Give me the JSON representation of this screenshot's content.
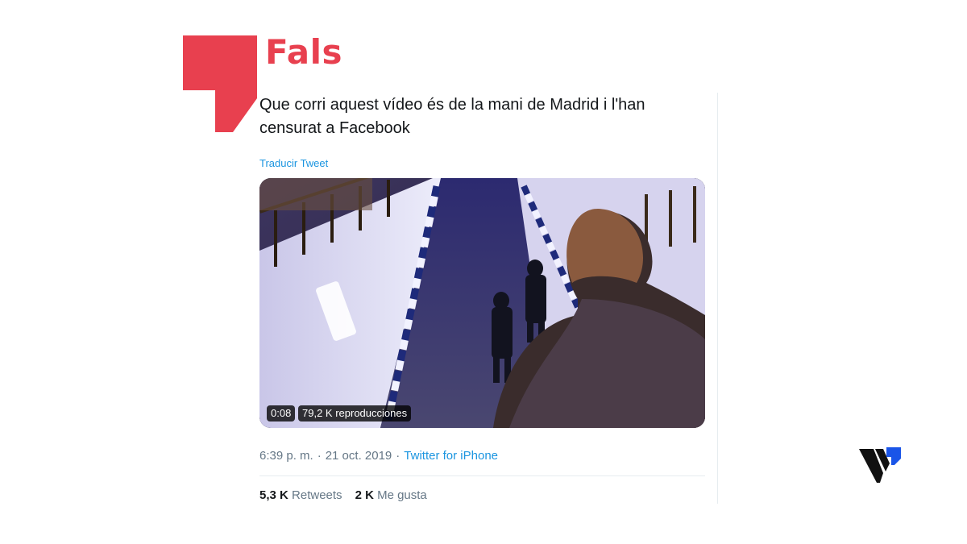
{
  "verdict": {
    "label": "Fals",
    "color": "#e8404f",
    "icon": "quote-mark-icon"
  },
  "tweet": {
    "text": "Que corri aquest vídeo és de la mani de Madrid i l'han censurat a Facebook",
    "translate_label": "Traducir Tweet",
    "video": {
      "duration": "0:08",
      "views": "79,2 K reproducciones"
    },
    "meta": {
      "time": "6:39 p. m.",
      "separator": "·",
      "date": "21 oct. 2019",
      "source": "Twitter for iPhone"
    },
    "stats": {
      "retweets_count": "5,3 K",
      "retweets_label": "Retweets",
      "likes_count": "2 K",
      "likes_label": "Me gusta"
    }
  },
  "brand": {
    "icon": "v-brand-logo",
    "accent": "#1a55e8"
  }
}
